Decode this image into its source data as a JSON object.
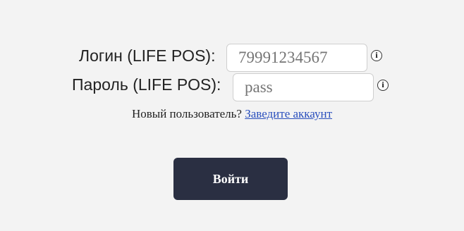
{
  "form": {
    "login_label": "Логин (LIFE POS):",
    "login_value": "79991234567",
    "password_label": "Пароль (LIFE POS):",
    "password_placeholder": "pass",
    "info_glyph": "i",
    "new_user_text": "Новый пользователь?",
    "register_link": "Заведите аккаунт",
    "submit_label": "Войти"
  }
}
